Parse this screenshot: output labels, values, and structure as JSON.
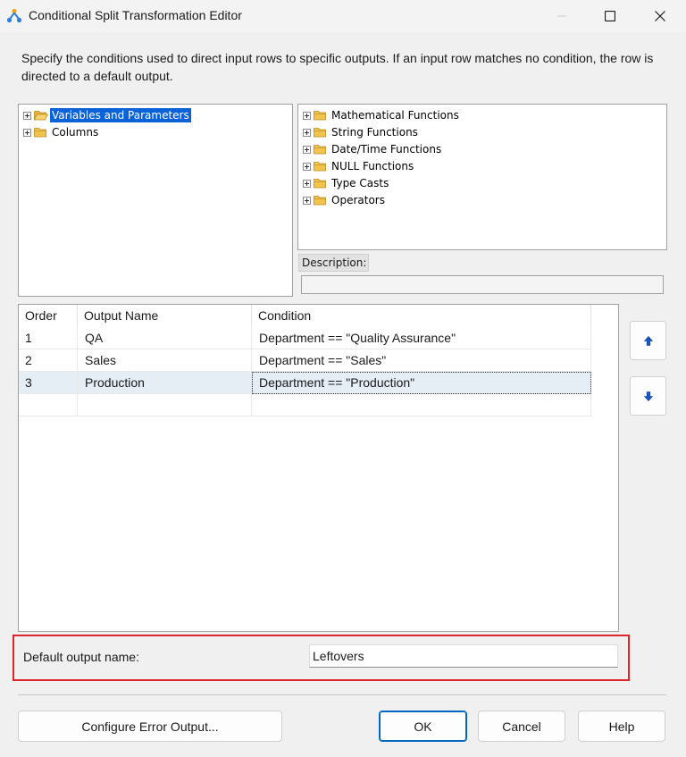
{
  "window": {
    "title": "Conditional Split Transformation Editor",
    "app_icon": "ssis-transform-icon",
    "controls": [
      "minimize-icon",
      "maximize-icon",
      "close-icon"
    ]
  },
  "instructions": "Specify the conditions used to direct input rows to specific outputs. If an input row matches no condition, the row is directed to a default output.",
  "variables_tree": {
    "items": [
      {
        "label": "Variables and Parameters",
        "selected": true,
        "icon": "folder-open-icon"
      },
      {
        "label": "Columns",
        "selected": false,
        "icon": "folder-icon"
      }
    ]
  },
  "functions_tree": {
    "items": [
      {
        "label": "Mathematical Functions",
        "icon": "folder-icon"
      },
      {
        "label": "String Functions",
        "icon": "folder-icon"
      },
      {
        "label": "Date/Time Functions",
        "icon": "folder-icon"
      },
      {
        "label": "NULL Functions",
        "icon": "folder-icon"
      },
      {
        "label": "Type Casts",
        "icon": "folder-icon"
      },
      {
        "label": "Operators",
        "icon": "folder-icon"
      }
    ]
  },
  "description": {
    "label": "Description:",
    "value": ""
  },
  "conditions_grid": {
    "columns": [
      "Order",
      "Output Name",
      "Condition"
    ],
    "rows": [
      {
        "order": "1",
        "output_name": "QA",
        "condition": "Department == \"Quality Assurance\""
      },
      {
        "order": "2",
        "output_name": "Sales",
        "condition": "Department == \"Sales\""
      },
      {
        "order": "3",
        "output_name": "Production",
        "condition": "Department == \"Production\"",
        "selected": true
      },
      {
        "order": "",
        "output_name": "",
        "condition": ""
      }
    ]
  },
  "reorder": {
    "up_icon": "arrow-up-icon",
    "down_icon": "arrow-down-icon"
  },
  "default_output": {
    "label": "Default output name:",
    "value": "Leftovers"
  },
  "buttons": {
    "configure_error": "Configure Error Output...",
    "ok": "OK",
    "cancel": "Cancel",
    "help": "Help"
  },
  "colors": {
    "selection": "#0a62d8",
    "highlight_border": "#d9262a",
    "primary_button_border": "#0067c0",
    "arrow": "#1a56c8",
    "folder": "#f2c44d"
  }
}
